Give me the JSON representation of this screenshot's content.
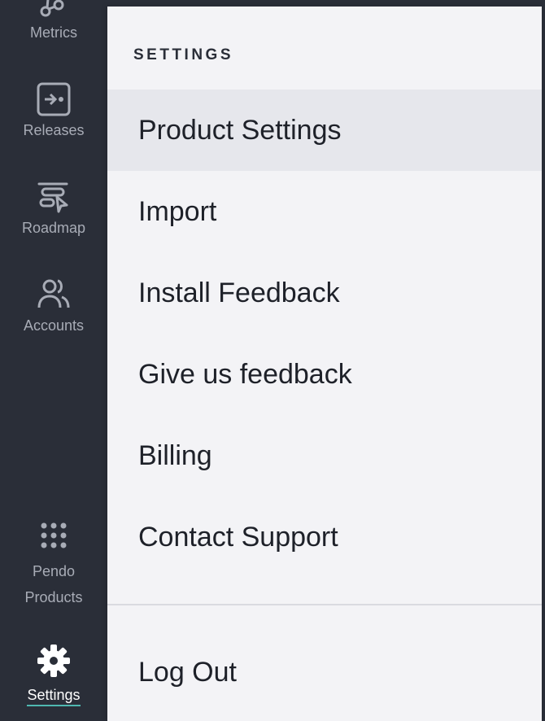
{
  "sidebar": {
    "items": [
      {
        "label": "Metrics",
        "icon": "metrics-icon"
      },
      {
        "label": "Releases",
        "icon": "releases-icon"
      },
      {
        "label": "Roadmap",
        "icon": "roadmap-icon"
      },
      {
        "label": "Accounts",
        "icon": "accounts-icon"
      },
      {
        "label_line1": "Pendo",
        "label_line2": "Products",
        "icon": "grid-dots-icon"
      },
      {
        "label": "Settings",
        "icon": "gear-icon"
      }
    ]
  },
  "settings_menu": {
    "header": "SETTINGS",
    "items": [
      {
        "label": "Product Settings"
      },
      {
        "label": "Import"
      },
      {
        "label": "Install Feedback"
      },
      {
        "label": "Give us feedback"
      },
      {
        "label": "Billing"
      },
      {
        "label": "Contact Support"
      }
    ],
    "logout_label": "Log Out"
  },
  "colors": {
    "sidebar_bg": "#2a2e38",
    "menu_bg": "#f3f3f6",
    "highlight_bg": "#e6e7ec",
    "accent_underline": "#4fb8b0"
  }
}
